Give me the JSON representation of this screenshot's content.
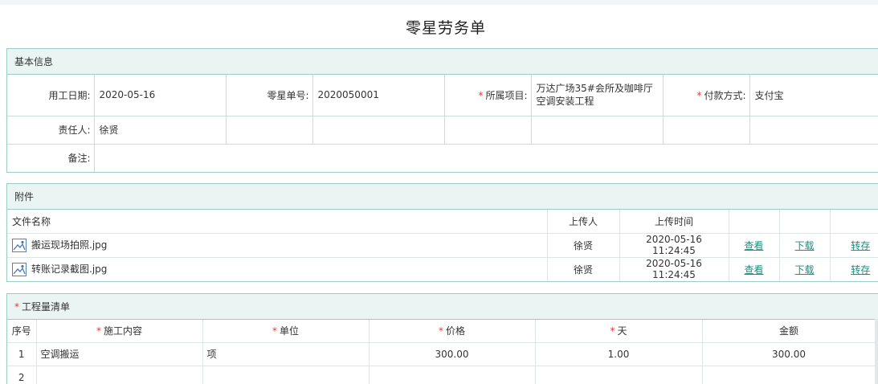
{
  "page": {
    "title": "零星劳务单"
  },
  "basic": {
    "header": "基本信息",
    "work_date_label": "用工日期:",
    "work_date": "2020-05-16",
    "order_no_label": "零星单号:",
    "order_no": "2020050001",
    "project_label": "所属项目:",
    "project_line1": "万达广场35#会所及咖啡厅",
    "project_line2": "空调安装工程",
    "payment_label": "付款方式:",
    "payment": "支付宝",
    "owner_label": "责任人:",
    "owner": "徐贤",
    "remark_label": "备注:",
    "remark": ""
  },
  "attachments": {
    "header": "附件",
    "columns": {
      "name": "文件名称",
      "uploader": "上传人",
      "time": "上传时间"
    },
    "rows": [
      {
        "name": "搬运现场拍照.jpg",
        "uploader": "徐贤",
        "time": "2020-05-16 11:24:45",
        "view": "查看",
        "download": "下载",
        "transfer": "转存"
      },
      {
        "name": "转账记录截图.jpg",
        "uploader": "徐贤",
        "time": "2020-05-16 11:24:45",
        "view": "查看",
        "download": "下载",
        "transfer": "转存"
      }
    ]
  },
  "quantity": {
    "header": "工程量清单",
    "columns": {
      "index": "序号",
      "content": "施工内容",
      "unit": "单位",
      "price": "价格",
      "days": "天",
      "amount": "金额"
    },
    "rows": [
      {
        "index": "1",
        "content": "空调搬运",
        "unit": "项",
        "price": "300.00",
        "days": "1.00",
        "amount": "300.00"
      },
      {
        "index": "2",
        "content": "",
        "unit": "",
        "price": "",
        "days": "",
        "amount": ""
      }
    ]
  },
  "colors": {
    "border": "#9ccbc6",
    "header_bg": "#eaf4f3",
    "link": "#1a8f7e",
    "required": "#e03a3a"
  }
}
